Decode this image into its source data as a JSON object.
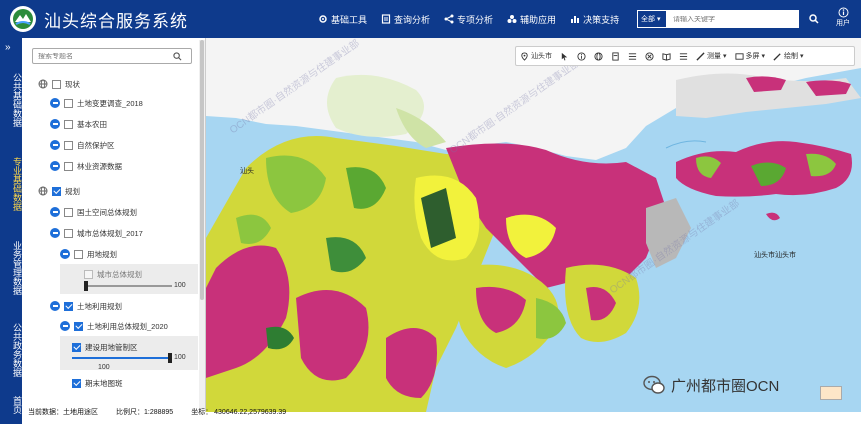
{
  "header": {
    "title": "汕头综合服务系统",
    "nav": [
      "基础工具",
      "查询分析",
      "专项分析",
      "辅助应用",
      "决策支持"
    ],
    "search_scope": "全部",
    "search_placeholder": "请输入关键字",
    "user_label": "用户"
  },
  "rail": {
    "top_glyph": "»",
    "categories": [
      "公共基础数据",
      "专业基础数据",
      "业务管理数据",
      "公共政务数据",
      "首页"
    ],
    "active_index": 1
  },
  "panel": {
    "search_placeholder": "搜索专题名",
    "tree": {
      "status_group": "现状",
      "status_items": [
        "土地变更调查_2018",
        "基本农田",
        "自然保护区",
        "林业资源数据"
      ],
      "planning_group": "规划",
      "planning_items": [
        "国土空间总体规划",
        "城市总体规划_2017"
      ],
      "land_use_plan": "用地规划",
      "city_master_plan_layer": "城市总体规划",
      "land_use_group": "土地利用规划",
      "land_use_master": "土地利用总体规划_2020",
      "construction_zone": "建设用地管制区",
      "period_end_map": "期末地图斑",
      "slider_max": "100"
    }
  },
  "map": {
    "toolbar": {
      "location": "汕头市",
      "measure_label": "测量",
      "multi_label": "多屏",
      "draw_label": "绘制"
    },
    "labels": {
      "shantou_west": "汕头",
      "shantou_port": "汕头市汕头市"
    },
    "watermark": "OCN都市圈·自然资源与住建事业部"
  },
  "status": {
    "current_data": "当前数据：土地用途区",
    "scale": "比例尺：1:288895",
    "coords": "坐标：  430646.22,2579639.39"
  },
  "brand": {
    "name": "广州都市圈OCN"
  },
  "colors": {
    "header_bg": "#0e3a8c",
    "accent": "#1e6fd9",
    "sea": "#a7d6f2",
    "land_pink": "#c8317a",
    "land_yellow": "#f2f23c",
    "land_green": "#8cc63f",
    "forest": "#2e7d32"
  }
}
